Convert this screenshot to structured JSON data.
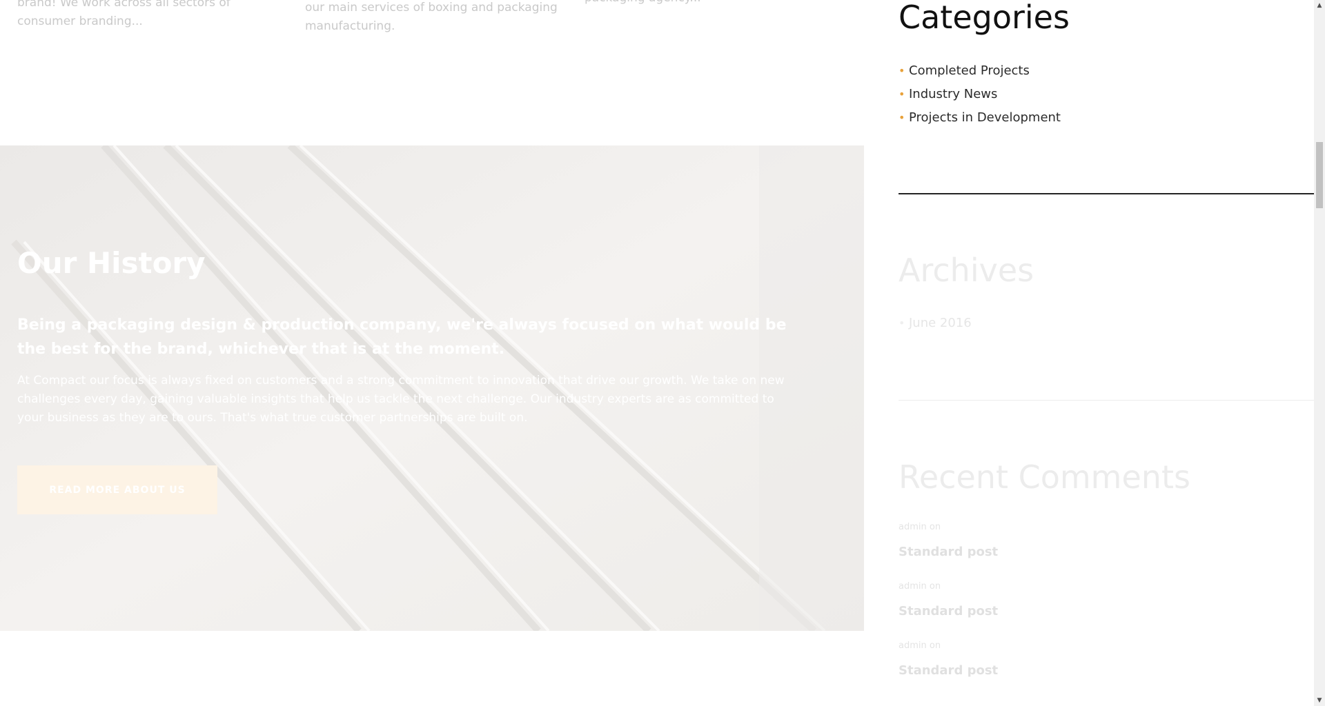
{
  "top": {
    "col1": "brand! We work across all sectors of consumer branding...",
    "col2": "our main services of boxing and packaging manufacturing.",
    "col3": "packaging agency..."
  },
  "history": {
    "title": "Our History",
    "lead": "Being a packaging design & production company, we're always focused on what would be the best for the brand, whichever that is at the moment.",
    "body": "At Compact our focus is always fixed on customers and a strong commitment to innovation that drive our growth. We take on new challenges every day, gaining valuable insights that help us tackle the next challenge. Our industry experts are as committed to your business as they are to ours. That's what true customer partnerships are built on.",
    "button": "Read more about us"
  },
  "sidebar": {
    "categories_title": "Categories",
    "categories": [
      "Completed Projects",
      "Industry News",
      "Projects in Development"
    ],
    "archives_title": "Archives",
    "archives": [
      "June 2016"
    ],
    "recent_comments_title": "Recent Comments",
    "recent_comments": [
      {
        "meta": "admin on",
        "link": "Standard post"
      },
      {
        "meta": "admin on",
        "link": "Standard post"
      },
      {
        "meta": "admin on",
        "link": "Standard post"
      }
    ]
  },
  "colors": {
    "accent": "#e8a13a",
    "button_bg": "#fdf3e5",
    "section_bg": "#f1efed"
  }
}
